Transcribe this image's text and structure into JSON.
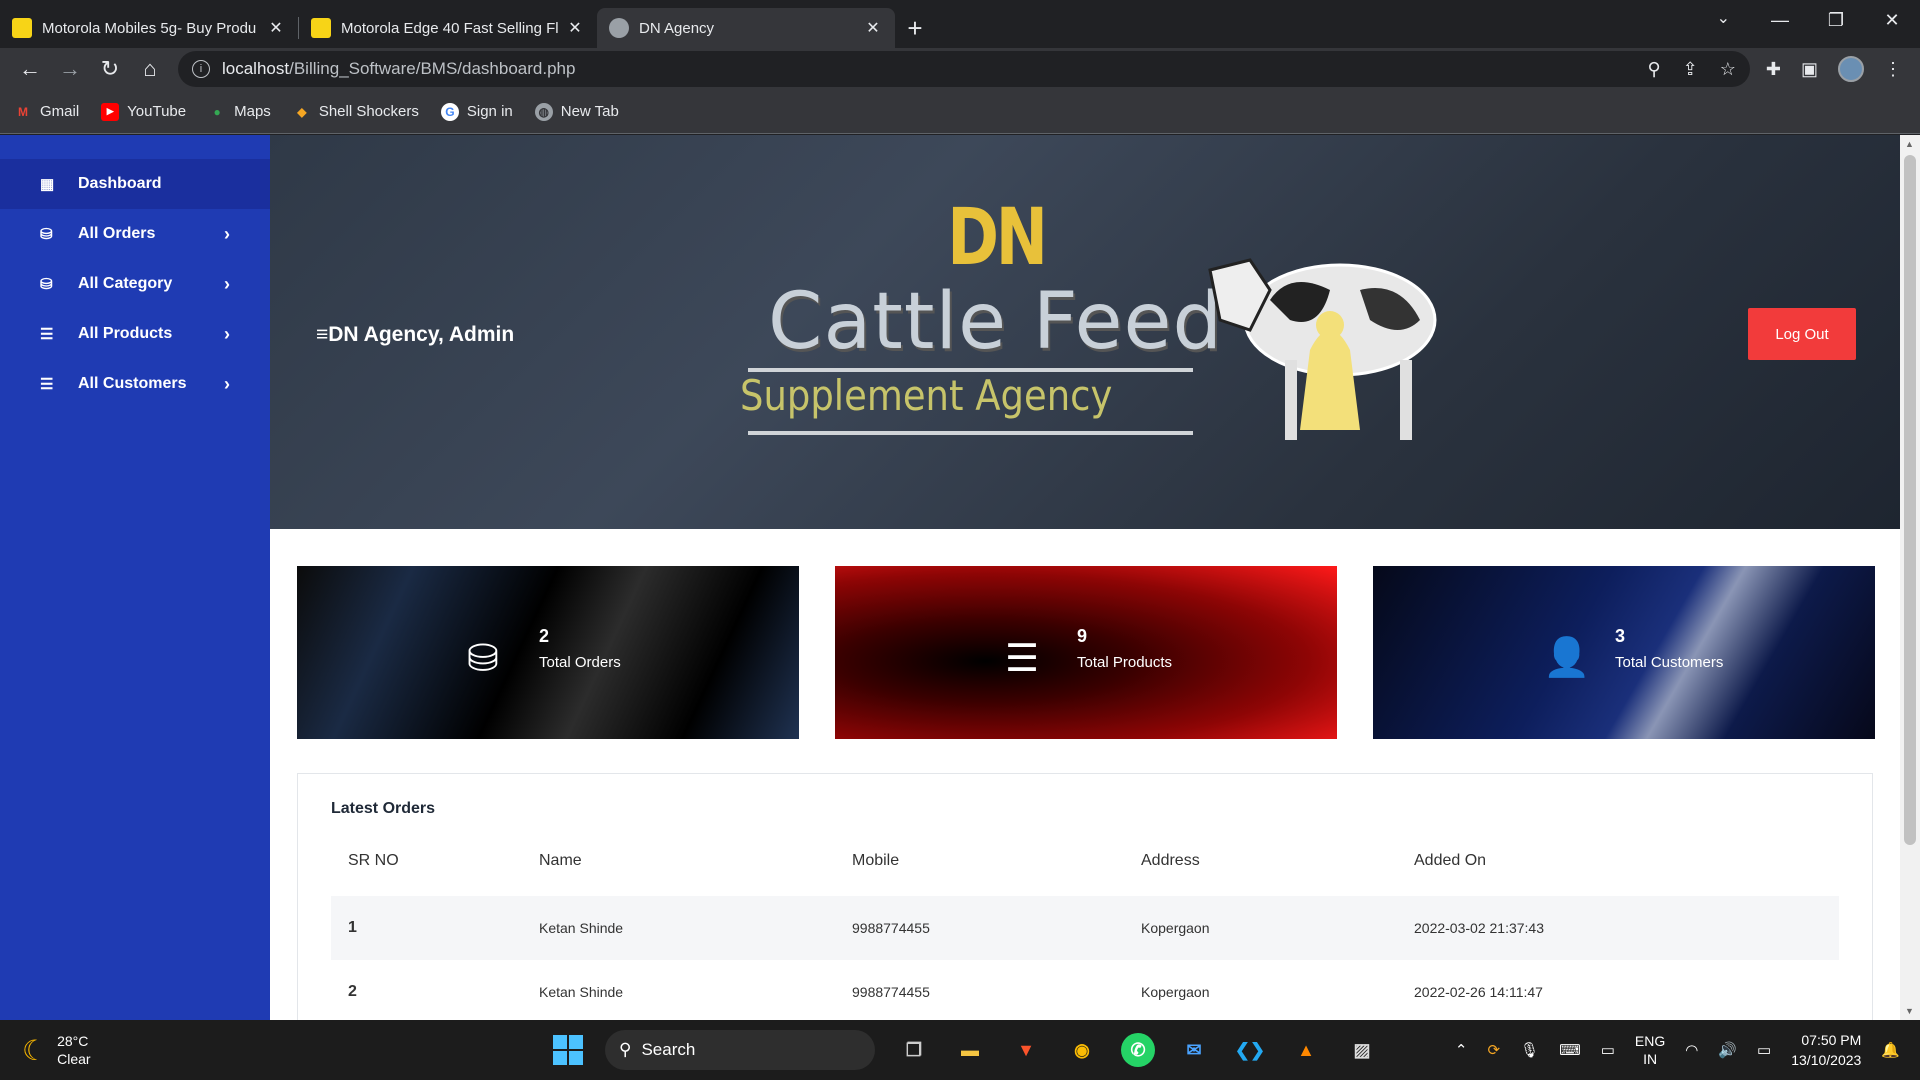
{
  "browser": {
    "tabs": [
      {
        "title": "Motorola Mobiles 5g- Buy Produ",
        "favicon_color": "#f7d417"
      },
      {
        "title": "Motorola Edge 40 Fast Selling Fl",
        "favicon_color": "#f7d417"
      },
      {
        "title": "DN Agency",
        "favicon_color": "#9aa0a6"
      }
    ],
    "url_host": "localhost",
    "url_path": "/Billing_Software/BMS/dashboard.php",
    "bookmarks": [
      {
        "label": "Gmail",
        "icon": "gmail-icon",
        "color": "#ea4335"
      },
      {
        "label": "YouTube",
        "icon": "youtube-icon",
        "color": "#ff0000"
      },
      {
        "label": "Maps",
        "icon": "maps-icon",
        "color": "#34a853"
      },
      {
        "label": "Shell Shockers",
        "icon": "shell-shockers-icon",
        "color": "#f5a623"
      },
      {
        "label": "Sign in",
        "icon": "google-icon",
        "color": "#ffffff"
      },
      {
        "label": "New Tab",
        "icon": "globe-icon",
        "color": "#9aa0a6"
      }
    ]
  },
  "sidebar": {
    "items": [
      {
        "label": "Dashboard",
        "icon": "dashboard-icon"
      },
      {
        "label": "All Orders",
        "icon": "basket-icon"
      },
      {
        "label": "All Category",
        "icon": "basket-icon"
      },
      {
        "label": "All Products",
        "icon": "list-icon"
      },
      {
        "label": "All Customers",
        "icon": "list-icon"
      }
    ]
  },
  "hero": {
    "welcome": "DN Agency, Admin",
    "logout_label": "Log Out",
    "logo_dn": "DN",
    "logo_line1": "Cattle Feed",
    "logo_line2": "Supplement Agency"
  },
  "stats": [
    {
      "value": "2",
      "label": "Total Orders",
      "icon": "basket-icon"
    },
    {
      "value": "9",
      "label": "Total Products",
      "icon": "list-icon"
    },
    {
      "value": "3",
      "label": "Total Customers",
      "icon": "user-icon"
    }
  ],
  "orders": {
    "title": "Latest Orders",
    "columns": [
      "SR NO",
      "Name",
      "Mobile",
      "Address",
      "Added On"
    ],
    "rows": [
      [
        "1",
        "Ketan Shinde",
        "9988774455",
        "Kopergaon",
        "2022-03-02 21:37:43"
      ],
      [
        "2",
        "Ketan Shinde",
        "9988774455",
        "Kopergaon",
        "2022-02-26 14:11:47"
      ]
    ]
  },
  "taskbar": {
    "temperature": "28°C",
    "weather": "Clear",
    "search_label": "Search",
    "lang_top": "ENG",
    "lang_bottom": "IN",
    "time": "07:50 PM",
    "date": "13/10/2023"
  },
  "colors": {
    "sidebar": "#1f3bb3",
    "logout": "#f23b3b"
  }
}
